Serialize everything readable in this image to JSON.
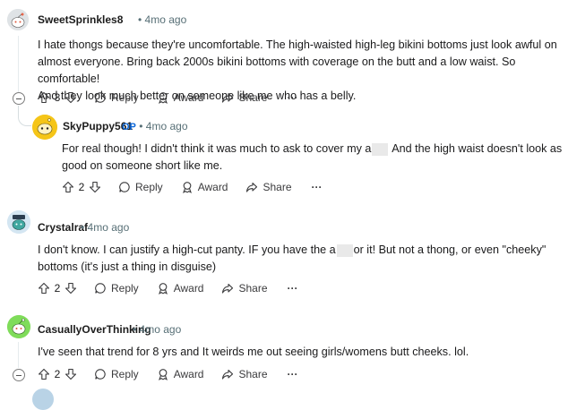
{
  "comments": [
    {
      "username": "SweetSprinkles8",
      "op": "",
      "time": "4mo ago",
      "lines": [
        "I hate thongs because they're uncomfortable. The high-waisted high-leg bikini bottoms just look awful on",
        "almost everyone. Bring back 2000s bikini bottoms with coverage on the butt and a low waist. So comfortable!",
        "And they look much better on someone like me who has a belly."
      ],
      "votes": "3",
      "reply": "Reply",
      "award": "Award",
      "share": "Share",
      "more": "···"
    },
    {
      "username": "SkyPuppy561",
      "op": "OP",
      "time": "4mo ago",
      "line1_pre": "For real though! I didn't think it was much to ask to cover my a",
      "line1_post": " And the high waist doesn't look as",
      "line2": "good on someone short like me.",
      "votes": "2",
      "reply": "Reply",
      "award": "Award",
      "share": "Share",
      "more": "···"
    },
    {
      "username": "Crystalraf",
      "op": "",
      "time": "4mo ago",
      "line1_pre": "I don't know. I can justify a high-cut panty. IF you have the a",
      "line1_post": "or it! But not a thong, or even \"cheeky\"",
      "line2": "bottoms (it's just a thing in disguise)",
      "votes": "2",
      "reply": "Reply",
      "award": "Award",
      "share": "Share",
      "more": "···"
    },
    {
      "username": "CasuallyOverThinking",
      "op": "",
      "time": "4mo ago",
      "line1": "I've seen that trend for 8 yrs and It weirds me out seeing girls/womens butt cheeks. lol.",
      "votes": "2",
      "reply": "Reply",
      "award": "Award",
      "share": "Share",
      "more": "···"
    }
  ],
  "separator": "•",
  "colors": {
    "op": "#0a66d8",
    "meta": "#576f76",
    "thread": "#e5ebee"
  }
}
